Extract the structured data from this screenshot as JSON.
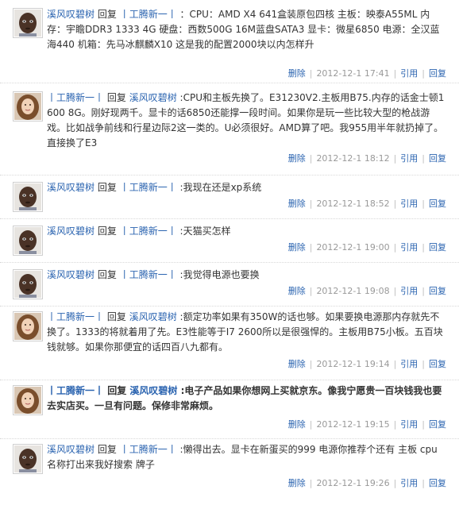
{
  "replies": [
    {
      "avatar": "boy-avatar",
      "user": "溪风叹碧树",
      "verb": "回复",
      "target": "丨工腾新一丨",
      "content": "：CPU：AMD X4 641盒装原包四核 主板：映泰A55ML 内存：宇瞻DDR3 1333 4G 硬盘：西数500G 16M蓝盘SATA3 显卡：微星6850 电源：全汉蓝海440 机箱：先马冰麒麟X10 这是我的配置2000块以内怎样升",
      "del": "删除",
      "time": "2012-12-1  17:41",
      "quote": "引用",
      "reply": "回复"
    },
    {
      "avatar": "girl-avatar",
      "user": "丨工腾新一丨",
      "verb": "回复",
      "target": "溪风叹碧树",
      "content": ":CPU和主板先换了。E31230V2.主板用B75.内存的话金士顿1600 8G。刚好现两千。显卡的话6850还能撑一段时间。如果你是玩一些比较大型的枪战游戏。比如战争前线和行星边际2这一类的。U必须很好。AMD算了吧。我955用半年就扔掉了。直接换了E3",
      "del": "删除",
      "time": "2012-12-1  18:12",
      "quote": "引用",
      "reply": "回复"
    },
    {
      "avatar": "boy-avatar",
      "user": "溪风叹碧树",
      "verb": "回复",
      "target": "丨工腾新一丨",
      "content": ":我现在还是xp系统",
      "del": "删除",
      "time": "2012-12-1  18:52",
      "quote": "引用",
      "reply": "回复"
    },
    {
      "avatar": "boy-avatar",
      "user": "溪风叹碧树",
      "verb": "回复",
      "target": "丨工腾新一丨",
      "content": ":天猫买怎样",
      "del": "删除",
      "time": "2012-12-1  19:00",
      "quote": "引用",
      "reply": "回复"
    },
    {
      "avatar": "boy-avatar",
      "user": "溪风叹碧树",
      "verb": "回复",
      "target": "丨工腾新一丨",
      "content": ":我觉得电源也要换",
      "del": "删除",
      "time": "2012-12-1  19:08",
      "quote": "引用",
      "reply": "回复"
    },
    {
      "avatar": "girl-avatar",
      "user": "丨工腾新一丨",
      "verb": "回复",
      "target": "溪风叹碧树",
      "content": ":额定功率如果有350W的话也够。如果要换电源那内存就先不换了。1333的将就着用了先。E3性能等于I7 2600所以是很强悍的。主板用B75小板。五百块钱就够。如果你那便宜的话四百八九都有。",
      "del": "删除",
      "time": "2012-12-1  19:14",
      "quote": "引用",
      "reply": "回复"
    },
    {
      "avatar": "girl-avatar",
      "user": "丨工腾新一丨",
      "verb": "回复",
      "target": "溪风叹碧树",
      "content": ":电子产品如果你想网上买就京东。像我宁愿贵一百块钱我也要去实店买。一旦有问题。保修非常麻烦。",
      "del": "删除",
      "time": "2012-12-1  19:15",
      "quote": "引用",
      "reply": "回复"
    },
    {
      "avatar": "boy-avatar",
      "user": "溪风叹碧树",
      "verb": "回复",
      "target": "丨工腾新一丨",
      "content": ":懒得出去。显卡在新蛋买的999 电源你推荐个还有 主板 cpu名称打出来我好搜索 牌子",
      "del": "删除",
      "time": "2012-12-1  19:26",
      "quote": "引用",
      "reply": "回复"
    }
  ]
}
